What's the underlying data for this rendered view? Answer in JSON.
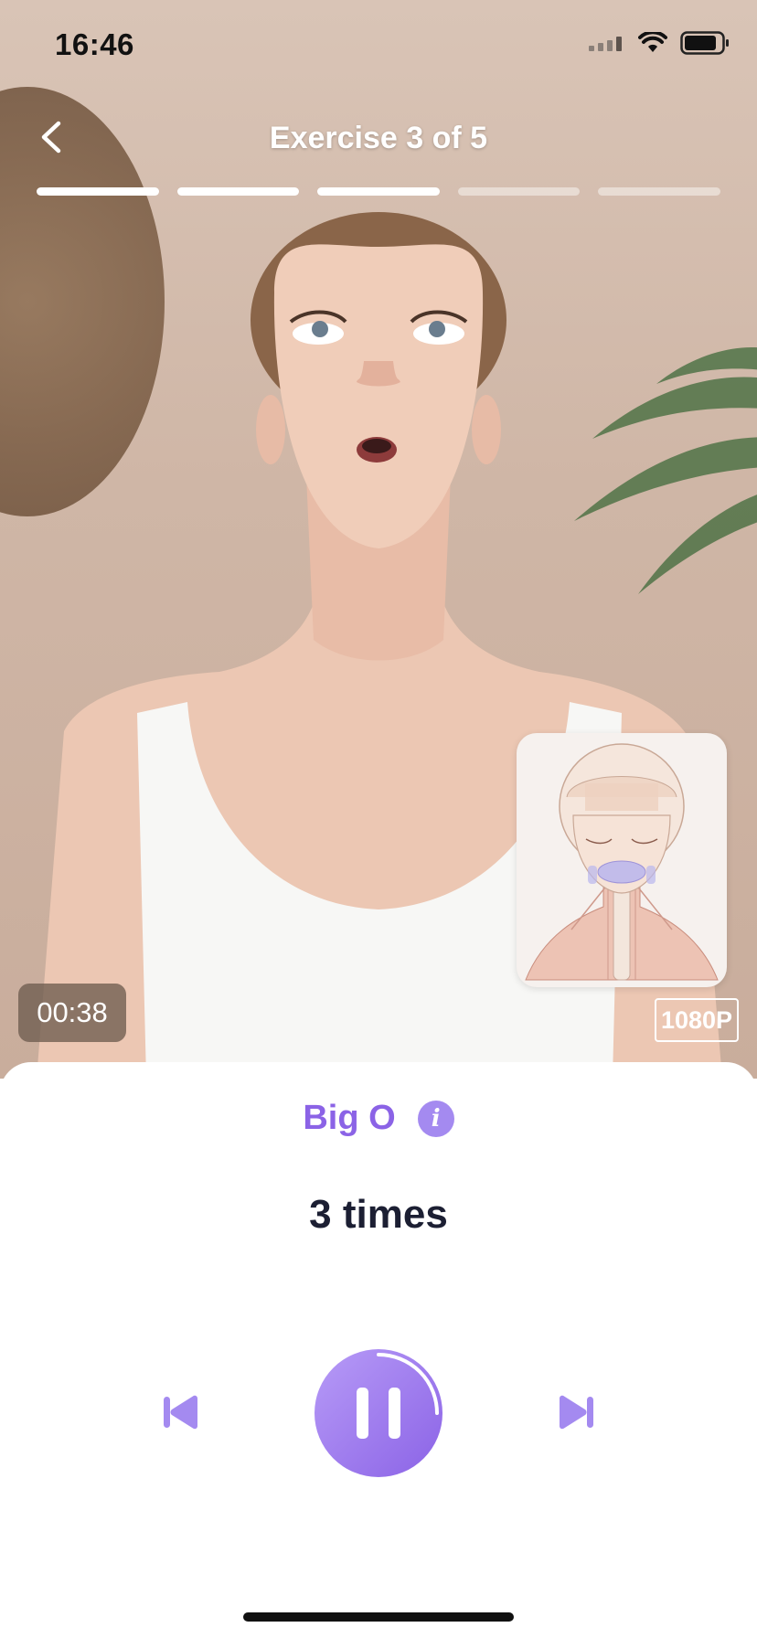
{
  "status_bar": {
    "time": "16:46"
  },
  "header": {
    "title": "Exercise 3 of 5",
    "progress": {
      "total": 5,
      "completed": 3
    }
  },
  "video": {
    "timer": "00:38",
    "resolution": "1080P"
  },
  "exercise": {
    "name": "Big O",
    "info_icon": "i",
    "reps": "3 times",
    "playback_progress": 0.25
  },
  "colors": {
    "accent": "#8b63e6",
    "accent_light": "#a48af0",
    "progress_active": "#ffffff",
    "progress_inactive": "rgba(255,255,255,0.45)",
    "text_dark": "#1c1f33"
  },
  "icons": {
    "back": "chevron-left-icon",
    "info": "info-icon",
    "previous": "skip-previous-icon",
    "pause": "pause-icon",
    "next": "skip-next-icon"
  }
}
